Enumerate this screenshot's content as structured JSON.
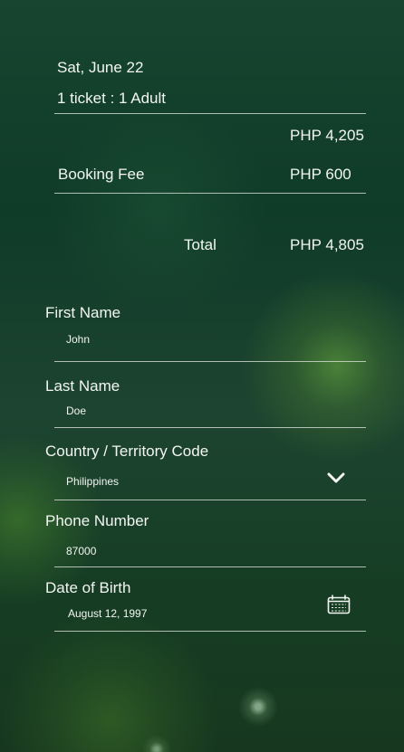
{
  "booking": {
    "date": "Sat, June 22",
    "ticket_summary": "1 ticket : 1 Adult",
    "ticket_price": "PHP 4,205",
    "booking_fee_label": "Booking Fee",
    "booking_fee_value": "PHP 600",
    "total_label": "Total",
    "total_value": "PHP 4,805"
  },
  "form": {
    "first_name": {
      "label": "First Name",
      "value": "John"
    },
    "last_name": {
      "label": "Last Name",
      "value": "Doe"
    },
    "country_code": {
      "label": "Country / Territory Code",
      "value": "Philippines",
      "icon": "chevron-down-icon"
    },
    "phone_number": {
      "label": "Phone Number",
      "value": "87000"
    },
    "date_of_birth": {
      "label": "Date of Birth",
      "value": "August 12, 1997",
      "icon": "calendar-icon"
    }
  },
  "colors": {
    "background_primary": "#0f3b29",
    "background_secondary": "#3d6f28",
    "text": "#f3f6f2",
    "divider": "#dce1dc"
  }
}
